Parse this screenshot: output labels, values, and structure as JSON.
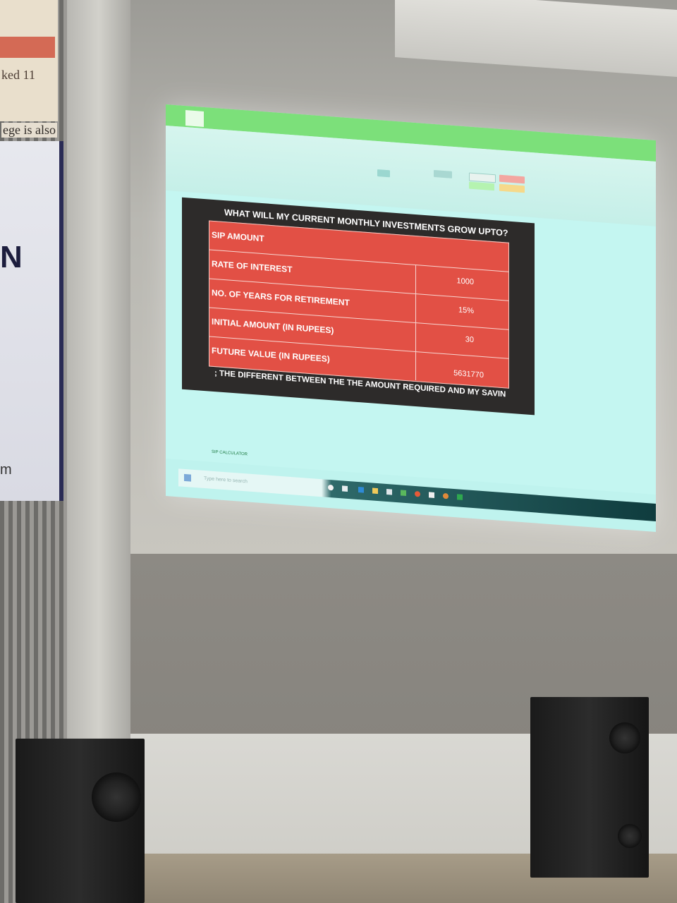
{
  "poster": {
    "line1": "ked 11",
    "line2": "ege is also",
    "banner_letter": "N",
    "banner_tail": "m"
  },
  "excel": {
    "sheet_tab": "SIP CALCULATOR",
    "taskbar_search": "Type here to search"
  },
  "slide": {
    "title": "WHAT WILL MY CURRENT MONTHLY INVESTMENTS GROW UPTO?",
    "rows": [
      {
        "label": "SIP AMOUNT",
        "value": ""
      },
      {
        "label": "RATE OF INTEREST",
        "value": "1000"
      },
      {
        "label": "NO. OF YEARS FOR RETIREMENT",
        "value": "15%"
      },
      {
        "label": "INITIAL AMOUNT (IN RUPEES)",
        "value": "30"
      },
      {
        "label": "FUTURE VALUE (IN RUPEES)",
        "value": "5631770"
      }
    ],
    "footer": "; THE DIFFERENT BETWEEN THE THE AMOUNT REQUIRED AND MY SAVIN"
  },
  "colors": {
    "table_red": "#e25045",
    "slide_dark": "#2d2b2a",
    "excel_green": "#7ce07a",
    "projection_cyan": "#c4f6f1"
  }
}
